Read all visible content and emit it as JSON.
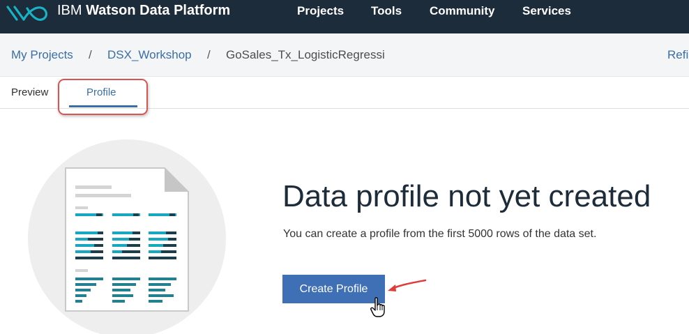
{
  "app": {
    "brand_light": "IBM",
    "brand_bold": "Watson Data Platform"
  },
  "nav": {
    "projects": "Projects",
    "tools": "Tools",
    "community": "Community",
    "services": "Services"
  },
  "breadcrumb": {
    "items": [
      "My Projects",
      "DSX_Workshop",
      "GoSales_Tx_LogisticRegressi"
    ],
    "separator": "/",
    "right_action": "Refi"
  },
  "tabs": [
    {
      "label": "Preview",
      "active": false
    },
    {
      "label": "Profile",
      "active": true
    }
  ],
  "empty_state": {
    "title": "Data profile not yet created",
    "message": "You can create a profile from the first 5000 rows of the data set.",
    "button_label": "Create Profile"
  },
  "icons": {
    "logo": "watson-logo-icon",
    "illustration": "document-profile-illustration",
    "annotation_arrow": "red-arrow-icon",
    "cursor": "hand-pointer-icon"
  },
  "colors": {
    "topbar": "#1d2c3a",
    "accent": "#3a6ea5",
    "button": "#3f6fb4",
    "annotation": "#d9534f",
    "teal": "#17a7c0"
  }
}
